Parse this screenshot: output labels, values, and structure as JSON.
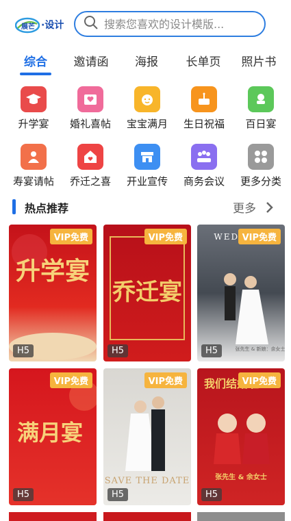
{
  "header": {
    "logo_text": "·设计",
    "logo_mark_text": "展芒",
    "search_placeholder": "搜索您喜欢的设计模版..."
  },
  "tabs": [
    {
      "label": "综合",
      "active": true
    },
    {
      "label": "邀请函",
      "active": false
    },
    {
      "label": "海报",
      "active": false
    },
    {
      "label": "长单页",
      "active": false
    },
    {
      "label": "照片书",
      "active": false
    }
  ],
  "categories": [
    {
      "label": "升学宴",
      "icon": "graduation-cap-icon",
      "color": "#e94b4b"
    },
    {
      "label": "婚礼喜帖",
      "icon": "heart-envelope-icon",
      "color": "#f06b9a"
    },
    {
      "label": "宝宝满月",
      "icon": "baby-face-icon",
      "color": "#f8b52a"
    },
    {
      "label": "生日祝福",
      "icon": "birthday-cake-icon",
      "color": "#f7941d"
    },
    {
      "label": "百日宴",
      "icon": "baby-stroller-icon",
      "color": "#5cc85a"
    },
    {
      "label": "寿宴请帖",
      "icon": "elder-person-icon",
      "color": "#f2704a"
    },
    {
      "label": "乔迁之喜",
      "icon": "house-heart-icon",
      "color": "#ee4444"
    },
    {
      "label": "开业宣传",
      "icon": "storefront-icon",
      "color": "#3d8ff2"
    },
    {
      "label": "商务会议",
      "icon": "meeting-people-icon",
      "color": "#8a6ff0"
    },
    {
      "label": "更多分类",
      "icon": "grid-more-icon",
      "color": "#9a9a9a"
    }
  ],
  "section": {
    "title": "热点推荐",
    "more_label": "更多"
  },
  "cards": [
    {
      "vip": "VIP免费",
      "badge": "H5",
      "title": "升学宴",
      "theme": "red"
    },
    {
      "vip": "VIP免费",
      "badge": "H5",
      "title": "乔迁宴",
      "theme": "red"
    },
    {
      "vip": "VIP免费",
      "badge": "H5",
      "title": "WEDDING",
      "theme": "photo",
      "names": "张先生 & 新娘：余女士"
    },
    {
      "vip": "VIP免费",
      "badge": "H5",
      "title": "满月宴",
      "theme": "red"
    },
    {
      "vip": "VIP免费",
      "badge": "H5",
      "title": "SAVE THE DATE",
      "theme": "photo-light"
    },
    {
      "vip": "VIP免费",
      "badge": "H5",
      "title": "我们结婚啦",
      "theme": "red-cartoon",
      "names": "张先生 & 余女士"
    }
  ]
}
